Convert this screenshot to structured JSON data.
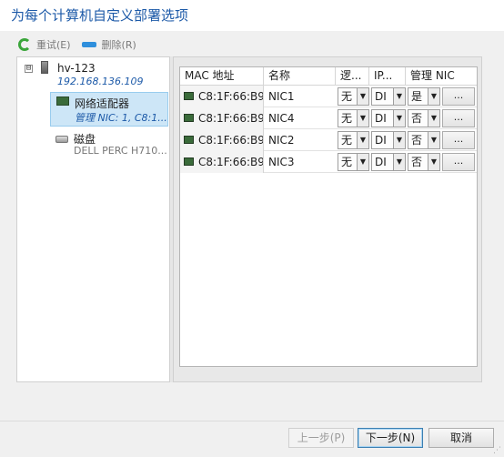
{
  "dialog": {
    "title": "为每个计算机自定义部署选项"
  },
  "toolbar": {
    "retry_label": "重试(E)",
    "remove_label": "删除(R)"
  },
  "tree": {
    "host_expander": "⊟",
    "host_name": "hv-123",
    "host_ip": "192.168.136.109",
    "network_label": "网络适配器",
    "network_sub": "管理 NIC: 1, C8:1...",
    "disk_label": "磁盘",
    "disk_sub": "DELL PERC H710..."
  },
  "grid": {
    "columns": [
      "MAC 地址",
      "名称",
      "逻...",
      "IP...",
      "管理 NIC"
    ],
    "rows": [
      {
        "mac": "C8:1F:66:B9...",
        "name": "NIC1",
        "logic": "无",
        "ip": "DI",
        "mgmt": "是",
        "action": "..."
      },
      {
        "mac": "C8:1F:66:B9...",
        "name": "NIC4",
        "logic": "无",
        "ip": "DI",
        "mgmt": "否",
        "action": "..."
      },
      {
        "mac": "C8:1F:66:B9...",
        "name": "NIC2",
        "logic": "无",
        "ip": "DI",
        "mgmt": "否",
        "action": "..."
      },
      {
        "mac": "C8:1F:66:B9...",
        "name": "NIC3",
        "logic": "无",
        "ip": "DI",
        "mgmt": "否",
        "action": "..."
      }
    ]
  },
  "footer": {
    "prev_label": "上一步(P)",
    "next_label": "下一步(N)",
    "cancel_label": "取消"
  },
  "icons": {
    "retry": "refresh-icon",
    "remove": "remove-icon",
    "server": "server-icon",
    "network_adapter": "network-adapter-icon",
    "disk": "disk-icon",
    "dropdown": "chevron-down-icon"
  },
  "colors": {
    "title": "#1d5aa8",
    "selection": "#cde6f7",
    "link_italic": "#1d5aa8"
  }
}
